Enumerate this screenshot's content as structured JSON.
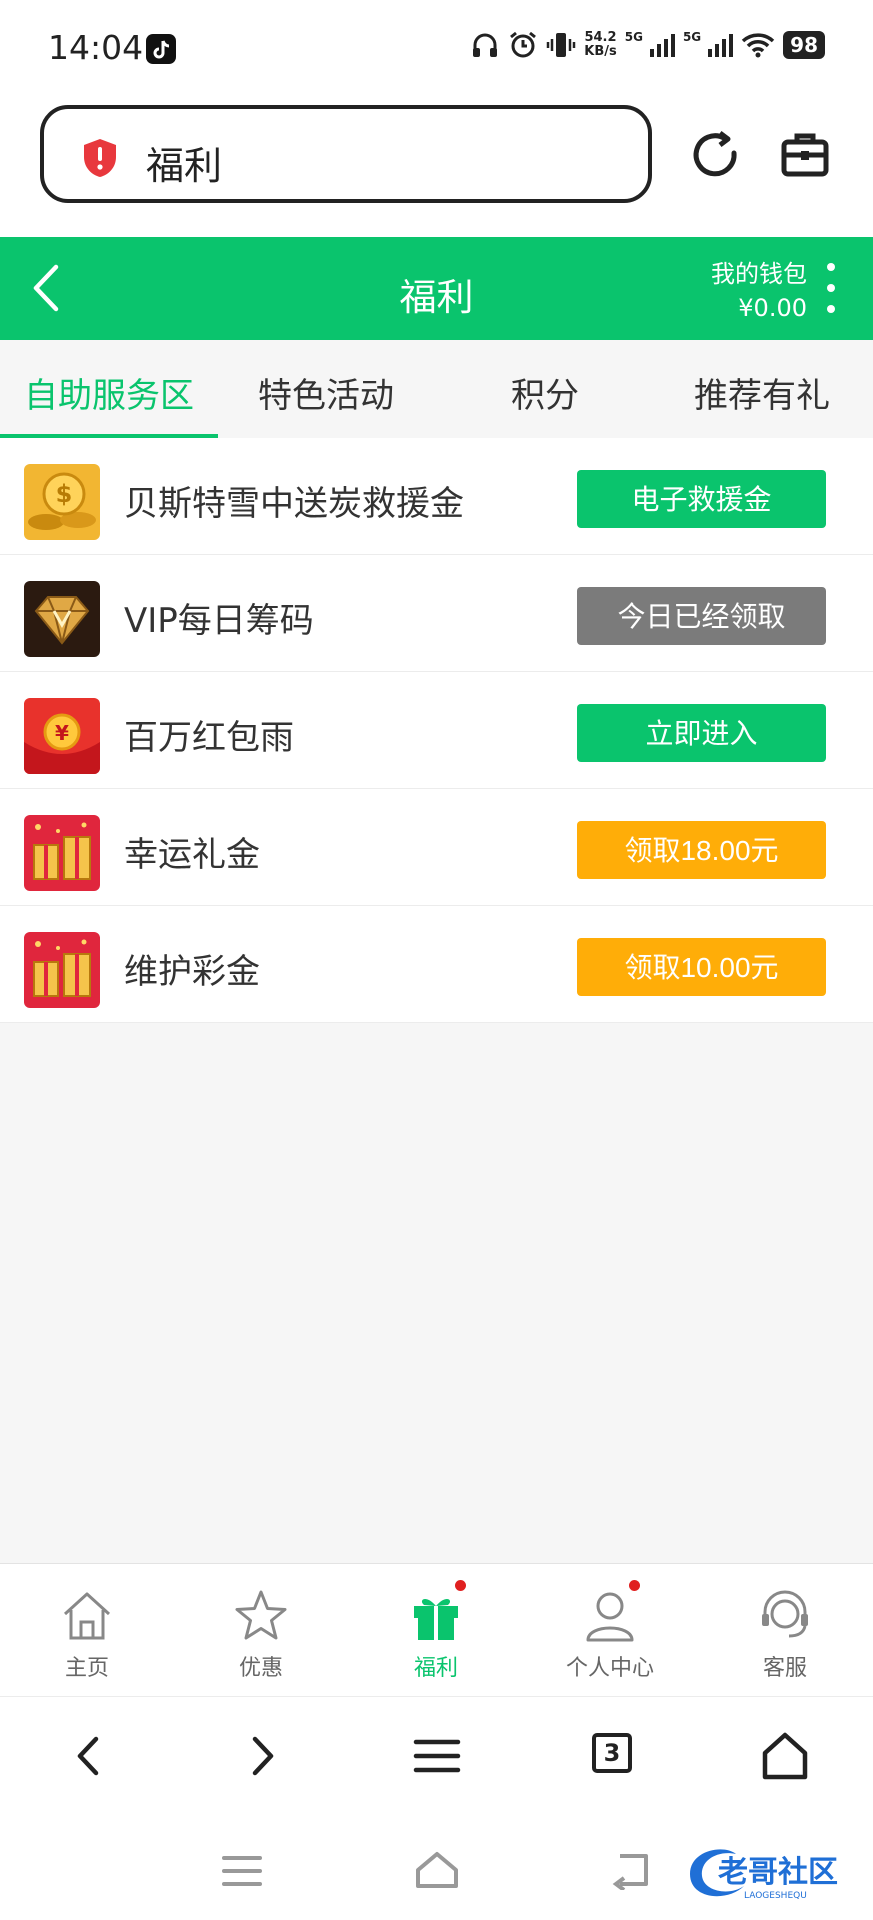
{
  "status": {
    "time": "14:04",
    "net_speed_value": "54.2",
    "net_speed_unit": "KB/s",
    "sig1_label": "5G",
    "sig2_label": "5G",
    "battery": "98"
  },
  "browser": {
    "url_text": "福利",
    "tab_count": "3"
  },
  "header": {
    "title": "福利",
    "wallet_label": "我的钱包",
    "wallet_amount": "¥0.00"
  },
  "tabs": [
    {
      "label": "自助服务区",
      "active": true
    },
    {
      "label": "特色活动",
      "active": false
    },
    {
      "label": "积分",
      "active": false
    },
    {
      "label": "推荐有礼",
      "active": false
    }
  ],
  "items": [
    {
      "name": "贝斯特雪中送炭救援金",
      "button": "电子救援金",
      "button_style": "green",
      "icon": "gold-coins-icon"
    },
    {
      "name": "VIP每日筹码",
      "button": "今日已经领取",
      "button_style": "gray",
      "icon": "vip-diamond-icon"
    },
    {
      "name": "百万红包雨",
      "button": "立即进入",
      "button_style": "green",
      "icon": "red-envelope-icon"
    },
    {
      "name": "幸运礼金",
      "button": "领取18.00元",
      "button_style": "orange",
      "icon": "lucky-gift-icon"
    },
    {
      "name": "维护彩金",
      "button": "领取10.00元",
      "button_style": "orange",
      "icon": "lucky-gift-icon"
    }
  ],
  "bottom_nav": [
    {
      "label": "主页",
      "icon": "home-icon"
    },
    {
      "label": "优惠",
      "icon": "star-icon"
    },
    {
      "label": "福利",
      "icon": "gift-icon",
      "active": true
    },
    {
      "label": "个人中心",
      "icon": "user-icon",
      "badge": true
    },
    {
      "label": "客服",
      "icon": "headset-icon"
    }
  ],
  "watermark": {
    "text": "老哥社区",
    "subtext": "LAOGESHEQU"
  },
  "colors": {
    "accent": "#0ac46d",
    "orange": "#ffad08",
    "gray_button": "#7b7b7b"
  }
}
